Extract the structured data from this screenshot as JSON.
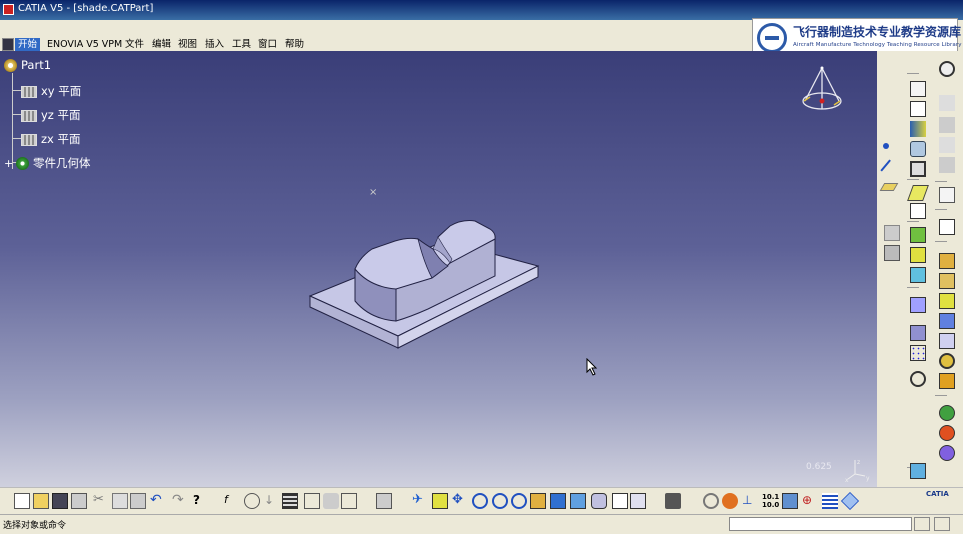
{
  "window": {
    "title": "CATIA V5 - [shade.CATPart]"
  },
  "menubar": {
    "items": [
      "开始",
      "ENOVIA V5 VPM",
      "文件",
      "编辑",
      "视图",
      "插入",
      "工具",
      "窗口",
      "帮助"
    ]
  },
  "logo": {
    "cn": "飞行器制造技术专业教学资源库",
    "en": "Aircraft Manufacture Technology Teaching Resource Library"
  },
  "tree": {
    "root": "Part1",
    "planes": [
      "xy 平面",
      "yz 平面",
      "zx 平面"
    ],
    "body": "零件几何体"
  },
  "viewport": {
    "zoom_readout": "0.625"
  },
  "statusbar": {
    "prompt": "选择对象或命令",
    "command_value": ""
  },
  "brand": {
    "label": "CATIA"
  },
  "colors": {
    "background_top": "#3a3e78",
    "background_bottom": "#cfd0de",
    "part_face": "#c8c9e8",
    "part_edge": "#222244",
    "toolbar_bg": "#ece9d8",
    "menu_highlight": "#316ac5"
  }
}
